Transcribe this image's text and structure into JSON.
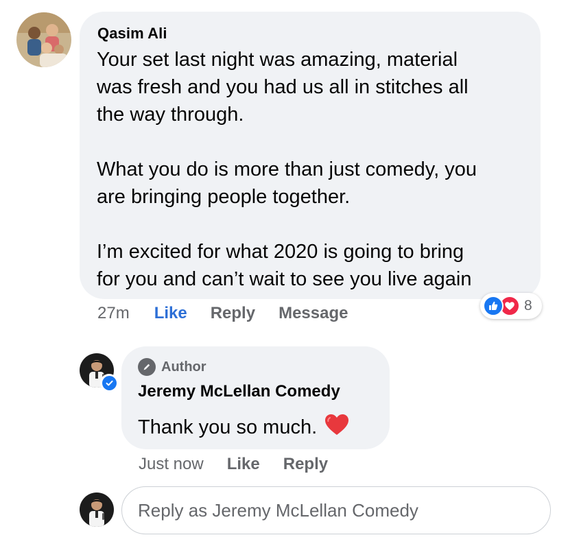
{
  "comment": {
    "author": "Qasim Ali",
    "text": "Your set last night was amazing, material\nwas fresh and you had us all in stitches all\nthe way through.\n\nWhat you do is more than just comedy, you\nare bringing people together.\n\nI’m excited for what 2020 is going to bring\nfor you and can’t wait to see you live again",
    "timestamp": "27m",
    "actions": {
      "like": "Like",
      "reply": "Reply",
      "message": "Message"
    },
    "reactions": {
      "icons": [
        "like-reaction-icon",
        "love-reaction-icon"
      ],
      "count": "8"
    },
    "colors": {
      "like_active": "#2d6fd6",
      "like_reaction": "#1877f2",
      "love_reaction": "#f02849"
    }
  },
  "reply": {
    "badge": "Author",
    "author": "Jeremy McLellan Comedy",
    "text": "Thank you so much.",
    "emoji": "heart-emoji",
    "timestamp": "Just now",
    "actions": {
      "like": "Like",
      "reply": "Reply"
    },
    "verified_icon": "verified-badge-icon"
  },
  "composer": {
    "placeholder": "Reply as Jeremy McLellan Comedy"
  }
}
